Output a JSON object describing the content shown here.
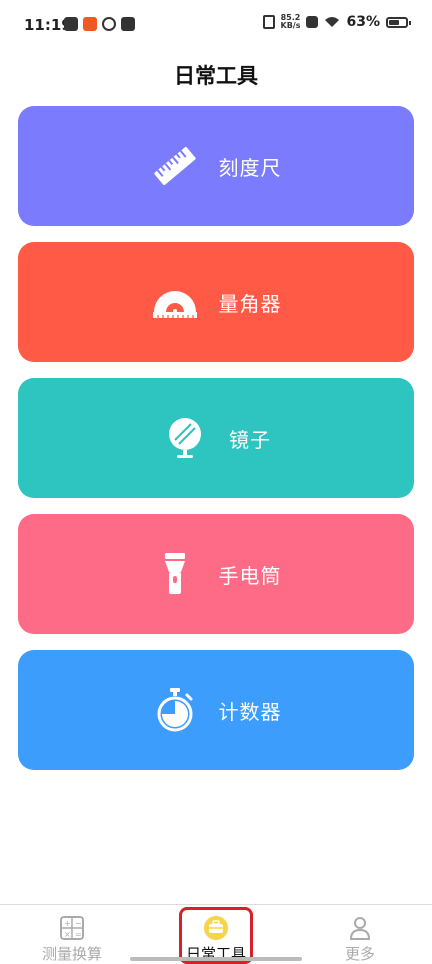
{
  "status_bar": {
    "time": "11:19",
    "net_speed_value": "85.2",
    "net_speed_unit": "KB/s",
    "battery_percent": "63%",
    "battery_level": 0.63
  },
  "header": {
    "title": "日常工具"
  },
  "tools": [
    {
      "label": "刻度尺",
      "icon": "ruler-icon",
      "color": "#7b7bfd"
    },
    {
      "label": "量角器",
      "icon": "protractor-icon",
      "color": "#ff5a46"
    },
    {
      "label": "镜子",
      "icon": "mirror-icon",
      "color": "#2ec4c0"
    },
    {
      "label": "手电筒",
      "icon": "flashlight-icon",
      "color": "#fe6b86"
    },
    {
      "label": "计数器",
      "icon": "stopwatch-icon",
      "color": "#3d9dfd"
    }
  ],
  "bottom_nav": {
    "items": [
      {
        "label": "测量换算",
        "icon": "calculator-icon",
        "active": false
      },
      {
        "label": "日常工具",
        "icon": "toolbox-icon",
        "active": true
      },
      {
        "label": "更多",
        "icon": "person-icon",
        "active": false
      }
    ],
    "active_color": "#f5d547",
    "highlight_color": "#d9202a"
  }
}
